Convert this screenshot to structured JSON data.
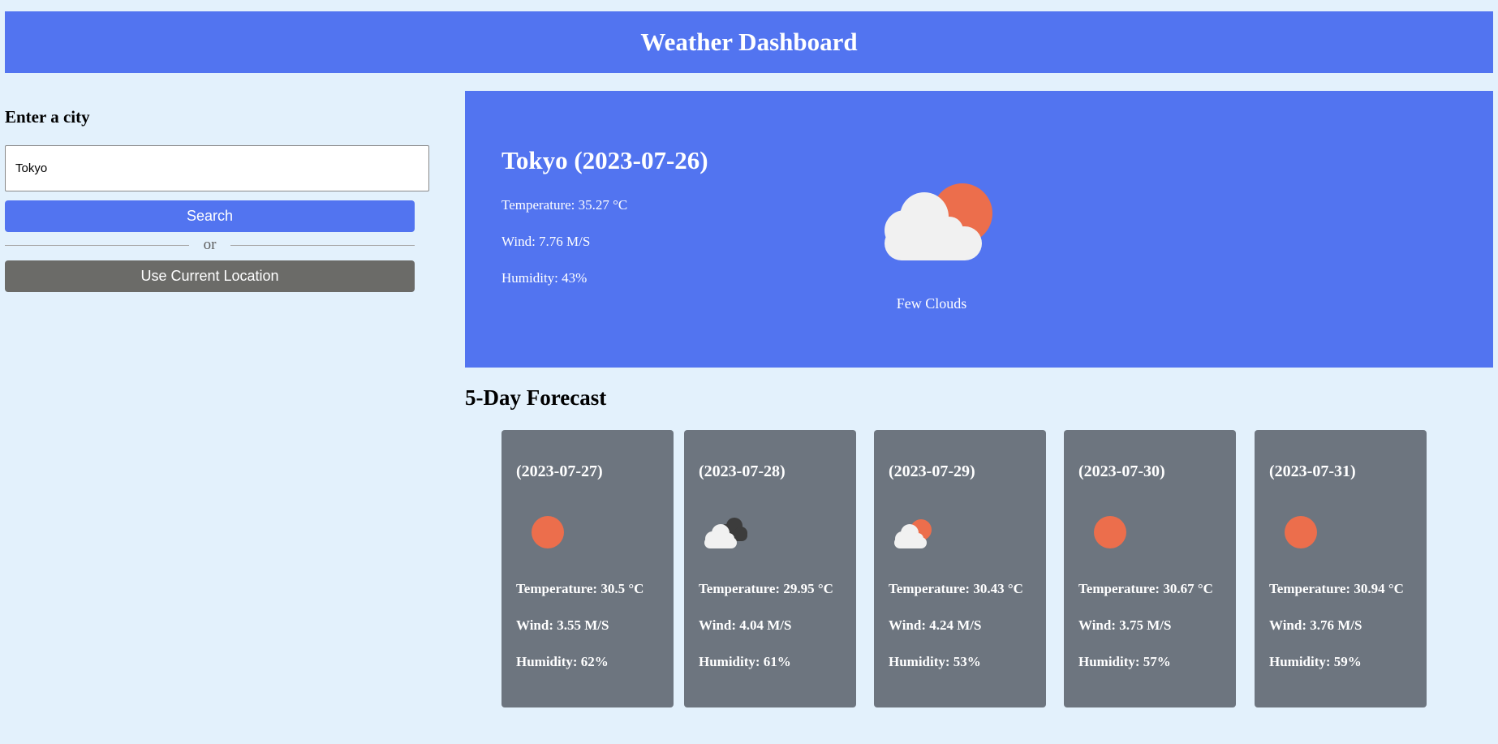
{
  "header": {
    "title": "Weather Dashboard"
  },
  "search": {
    "heading": "Enter a city",
    "value": "Tokyo",
    "search_label": "Search",
    "divider_text": "or",
    "location_label": "Use Current Location"
  },
  "current": {
    "title": "Tokyo (2023-07-26)",
    "temperature": "Temperature: 35.27 °C",
    "wind": "Wind: 7.76 M/S",
    "humidity": "Humidity: 43%",
    "icon": "few-clouds-icon",
    "description": "Few Clouds"
  },
  "forecast": {
    "title": "5-Day Forecast",
    "days": [
      {
        "date": "(2023-07-27)",
        "icon": "clear-sky-icon",
        "temperature": "Temperature: 30.5 °C",
        "wind": "Wind: 3.55 M/S",
        "humidity": "Humidity: 62%"
      },
      {
        "date": "(2023-07-28)",
        "icon": "broken-clouds-icon",
        "temperature": "Temperature: 29.95 °C",
        "wind": "Wind: 4.04 M/S",
        "humidity": "Humidity: 61%"
      },
      {
        "date": "(2023-07-29)",
        "icon": "few-clouds-icon",
        "temperature": "Temperature: 30.43 °C",
        "wind": "Wind: 4.24 M/S",
        "humidity": "Humidity: 53%"
      },
      {
        "date": "(2023-07-30)",
        "icon": "clear-sky-icon",
        "temperature": "Temperature: 30.67 °C",
        "wind": "Wind: 3.75 M/S",
        "humidity": "Humidity: 57%"
      },
      {
        "date": "(2023-07-31)",
        "icon": "clear-sky-icon",
        "temperature": "Temperature: 30.94 °C",
        "wind": "Wind: 3.76 M/S",
        "humidity": "Humidity: 59%"
      }
    ]
  },
  "colors": {
    "background": "#e3f1fc",
    "accent": "#5274f0",
    "card": "#6d757f",
    "location_button": "#6b6b68",
    "sun": "#ec6e4c",
    "cloud": "#f1f1f1",
    "dark_cloud": "#3c3c3c"
  }
}
